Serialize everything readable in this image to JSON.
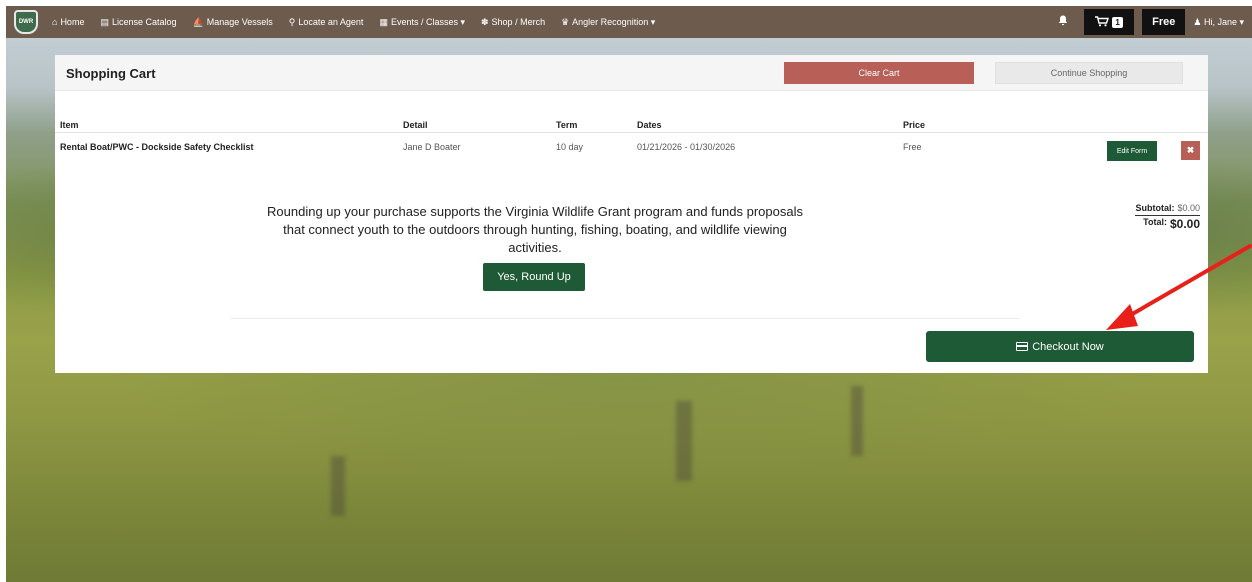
{
  "nav": {
    "logo_text": "DWR",
    "items": [
      {
        "label": "Home",
        "icon": "home-icon",
        "glyph": "⌂"
      },
      {
        "label": "License Catalog",
        "icon": "card-icon",
        "glyph": "▤"
      },
      {
        "label": "Manage Vessels",
        "icon": "boat-icon",
        "glyph": "⛵"
      },
      {
        "label": "Locate an Agent",
        "icon": "location-pin-icon",
        "glyph": "⚲"
      },
      {
        "label": "Events / Classes ▾",
        "icon": "calendar-icon",
        "glyph": "▦"
      },
      {
        "label": "Shop / Merch",
        "icon": "gift-icon",
        "glyph": "✽"
      },
      {
        "label": "Angler Recognition ▾",
        "icon": "trophy-icon",
        "glyph": "♛"
      }
    ],
    "cart_count": "1",
    "price": "Free",
    "user_greeting": "Hi, Jane ▾"
  },
  "panel": {
    "title": "Shopping Cart",
    "clear_label": "Clear Cart",
    "continue_label": "Continue Shopping"
  },
  "table": {
    "headers": [
      "Item",
      "Detail",
      "Term",
      "Dates",
      "Price"
    ],
    "row": {
      "item": "Rental Boat/PWC - Dockside Safety Checklist",
      "detail": "Jane D Boater",
      "term": "10 day",
      "dates": "01/21/2026 - 01/30/2026",
      "price": "Free",
      "edit_label": "Edit Form",
      "remove_label": "✖"
    }
  },
  "roundup": {
    "text": "Rounding up your purchase supports the Virginia Wildlife Grant program and funds proposals that connect youth to the outdoors through hunting, fishing, boating, and wildlife viewing activities.",
    "button_label": "Yes, Round Up"
  },
  "totals": {
    "subtotal_label": "Subtotal:",
    "subtotal_value": "$0.00",
    "total_label": "Total:",
    "total_value": "$0.00"
  },
  "checkout": {
    "label": "Checkout Now"
  },
  "colors": {
    "navbar": "#6d5b4d",
    "primary_green": "#1e5a35",
    "danger": "#b86058",
    "arrow": "#e8201a"
  }
}
